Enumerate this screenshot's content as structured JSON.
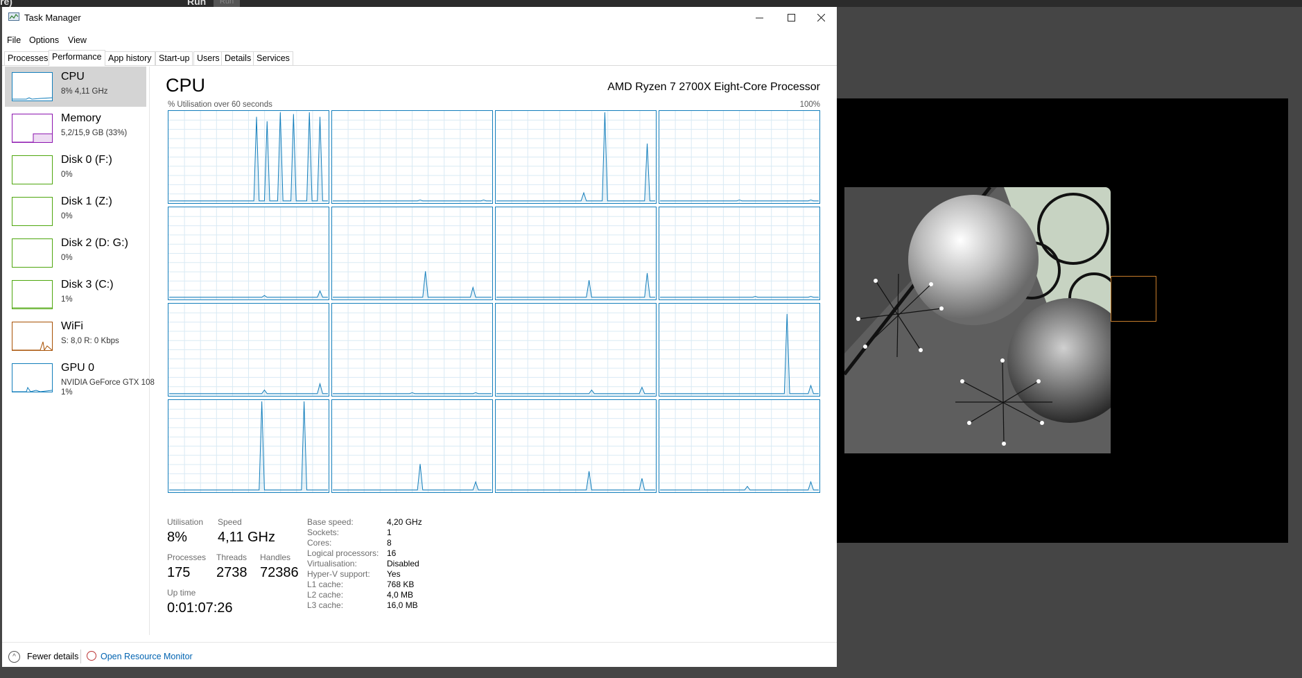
{
  "window": {
    "title": "Task Manager"
  },
  "menu": [
    "File",
    "Options",
    "View"
  ],
  "tabs": [
    "Processes",
    "Performance",
    "App history",
    "Start-up",
    "Users",
    "Details",
    "Services"
  ],
  "background": {
    "run_label": "Run",
    "window_label": "re)"
  },
  "sidebar": [
    {
      "name": "CPU",
      "sub": "8%  4,11 GHz",
      "color": "#117dbb"
    },
    {
      "name": "Memory",
      "sub": "5,2/15,9 GB (33%)",
      "color": "#8b12ae"
    },
    {
      "name": "Disk 0 (F:)",
      "sub": "0%",
      "color": "#4da60c"
    },
    {
      "name": "Disk 1 (Z:)",
      "sub": "0%",
      "color": "#4da60c"
    },
    {
      "name": "Disk 2 (D: G:)",
      "sub": "0%",
      "color": "#4da60c"
    },
    {
      "name": "Disk 3 (C:)",
      "sub": "1%",
      "color": "#4da60c"
    },
    {
      "name": "WiFi",
      "sub": "S: 8,0  R: 0 Kbps",
      "color": "#a74f01"
    },
    {
      "name": "GPU 0",
      "sub": "NVIDIA GeForce GTX 108",
      "sub2": "1%",
      "color": "#117dbb"
    }
  ],
  "main": {
    "title": "CPU",
    "model": "AMD Ryzen 7 2700X Eight-Core Processor",
    "util_label": "% Utilisation over 60 seconds",
    "util_max": "100%"
  },
  "stats": {
    "utilisation_label": "Utilisation",
    "utilisation": "8%",
    "speed_label": "Speed",
    "speed": "4,11 GHz",
    "processes_label": "Processes",
    "processes": "175",
    "threads_label": "Threads",
    "threads": "2738",
    "handles_label": "Handles",
    "handles": "72386",
    "uptime_label": "Up time",
    "uptime": "0:01:07:26"
  },
  "specs": [
    {
      "k": "Base speed:",
      "v": "4,20 GHz"
    },
    {
      "k": "Sockets:",
      "v": "1"
    },
    {
      "k": "Cores:",
      "v": "8"
    },
    {
      "k": "Logical processors:",
      "v": "16"
    },
    {
      "k": "Virtualisation:",
      "v": "Disabled"
    },
    {
      "k": "Hyper-V support:",
      "v": "Yes"
    },
    {
      "k": "L1 cache:",
      "v": "768 KB"
    },
    {
      "k": "L2 cache:",
      "v": "4,0 MB"
    },
    {
      "k": "L3 cache:",
      "v": "16,0 MB"
    }
  ],
  "footer": {
    "fewer": "Fewer details",
    "resource_monitor": "Open Resource Monitor"
  },
  "core_usage": [
    [
      0,
      0,
      0,
      0,
      0,
      0,
      0,
      0,
      0,
      0,
      0,
      0,
      0,
      0,
      0,
      0,
      0,
      0,
      0,
      0,
      0,
      0,
      0,
      0,
      0,
      0,
      0,
      0,
      0,
      0,
      0,
      0,
      0,
      0,
      0,
      0,
      0,
      0,
      0,
      0,
      0,
      0,
      0,
      0,
      0,
      0,
      0,
      0,
      0,
      0,
      0,
      0,
      0,
      0,
      0,
      0,
      0,
      0,
      0,
      0,
      0,
      0,
      0,
      0,
      0,
      0,
      0,
      0,
      0,
      0,
      0,
      0,
      0,
      0,
      0,
      0,
      0,
      0,
      0,
      0,
      0,
      0,
      0,
      0,
      0,
      0,
      0,
      0,
      0,
      0,
      0,
      0,
      0,
      0,
      0,
      0,
      0,
      0,
      0,
      0,
      0,
      0,
      0,
      0,
      0,
      0,
      0,
      0,
      0,
      0,
      0,
      0,
      0,
      0,
      0,
      0,
      0,
      0,
      0,
      0,
      0,
      0
    ],
    [],
    [],
    [],
    [],
    [],
    [],
    [],
    [],
    [],
    [],
    [],
    [],
    [],
    [],
    []
  ]
}
